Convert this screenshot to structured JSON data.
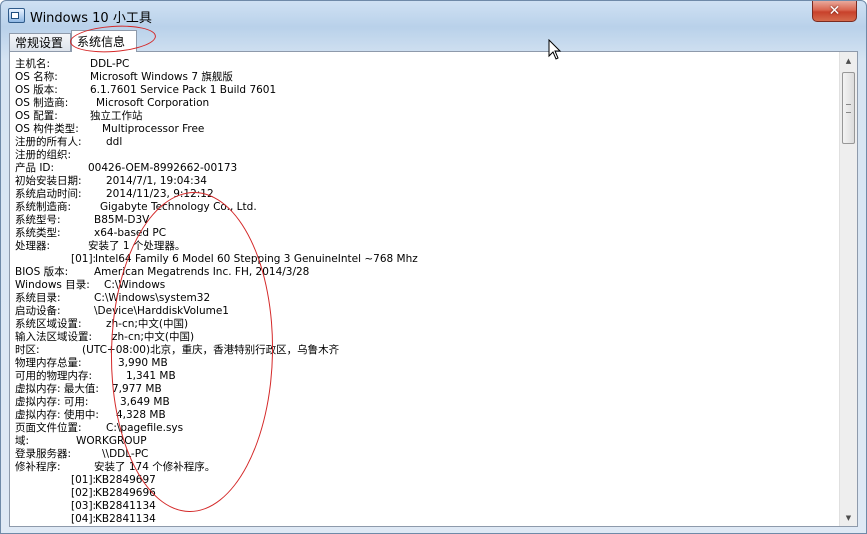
{
  "window": {
    "title": "Windows 10 小工具",
    "close_glyph": "✕"
  },
  "tabs": [
    {
      "label": "常规设置",
      "selected": false
    },
    {
      "label": "系统信息",
      "selected": true
    }
  ],
  "info": {
    "host_name": {
      "label": "主机名:",
      "value": "DDL-PC"
    },
    "os_name": {
      "label": "OS 名称:",
      "value": "Microsoft Windows 7 旗舰版"
    },
    "os_version": {
      "label": "OS 版本:",
      "value": "6.1.7601 Service Pack 1 Build 7601"
    },
    "os_manufacturer": {
      "label": "OS 制造商:",
      "value": "Microsoft Corporation"
    },
    "os_config": {
      "label": "OS 配置:",
      "value": "独立工作站"
    },
    "os_build_type": {
      "label": "OS 构件类型:",
      "value": "Multiprocessor Free"
    },
    "registered_owner": {
      "label": "注册的所有人:",
      "value": "ddl"
    },
    "registered_org": {
      "label": "注册的组织:",
      "value": ""
    },
    "product_id": {
      "label": "产品 ID:",
      "value": "00426-OEM-8992662-00173"
    },
    "install_date": {
      "label": "初始安装日期:",
      "value": "2014/7/1, 19:04:34"
    },
    "boot_time": {
      "label": "系统启动时间:",
      "value": "2014/11/23, 9:12:12"
    },
    "sys_manufacturer": {
      "label": "系统制造商:",
      "value": "Gigabyte Technology Co., Ltd."
    },
    "sys_model": {
      "label": "系统型号:",
      "value": "B85M-D3V"
    },
    "sys_type": {
      "label": "系统类型:",
      "value": "x64-based PC"
    },
    "processor": {
      "label": "处理器:",
      "value": "安装了 1 个处理器。"
    },
    "processor_item": {
      "label": "[01]:",
      "value": "Intel64 Family 6 Model 60 Stepping 3 GenuineIntel ~768 Mhz"
    },
    "bios_version": {
      "label": "BIOS 版本:",
      "value": "American Megatrends Inc. FH, 2014/3/28"
    },
    "windows_dir": {
      "label": "Windows 目录:",
      "value": "C:\\Windows"
    },
    "system_dir": {
      "label": "系统目录:",
      "value": "C:\\Windows\\system32"
    },
    "boot_device": {
      "label": "启动设备:",
      "value": "\\Device\\HarddiskVolume1"
    },
    "system_locale": {
      "label": "系统区域设置:",
      "value": "zh-cn;中文(中国)"
    },
    "input_locale": {
      "label": "输入法区域设置:",
      "value": "zh-cn;中文(中国)"
    },
    "time_zone": {
      "label": "时区:",
      "value": "(UTC+08:00)北京，重庆，香港特别行政区，乌鲁木齐"
    },
    "total_mem": {
      "label": "物理内存总量:",
      "value": "3,990 MB"
    },
    "avail_mem": {
      "label": "可用的物理内存:",
      "value": "1,341 MB"
    },
    "vmem_max": {
      "label": "虚拟内存: 最大值:",
      "value": "7,977 MB"
    },
    "vmem_avail": {
      "label": "虚拟内存: 可用:",
      "value": "3,649 MB"
    },
    "vmem_used": {
      "label": "虚拟内存: 使用中:",
      "value": "4,328 MB"
    },
    "page_file": {
      "label": "页面文件位置:",
      "value": "C:\\pagefile.sys"
    },
    "domain": {
      "label": "域:",
      "value": "WORKGROUP"
    },
    "logon_server": {
      "label": "登录服务器:",
      "value": "\\\\DDL-PC"
    },
    "hotfixes": {
      "label": "修补程序:",
      "value": "安装了 174 个修补程序。"
    },
    "hotfix_items": [
      {
        "label": "[01]:",
        "value": "KB2849697"
      },
      {
        "label": "[02]:",
        "value": "KB2849696"
      },
      {
        "label": "[03]:",
        "value": "KB2841134"
      },
      {
        "label": "[04]:",
        "value": "KB2841134"
      }
    ]
  },
  "scrollbar": {
    "up_glyph": "▲",
    "down_glyph": "▼"
  },
  "colors": {
    "annotation": "#d42828",
    "close": "#c8412b",
    "titlebar": "#b9d1ea"
  }
}
